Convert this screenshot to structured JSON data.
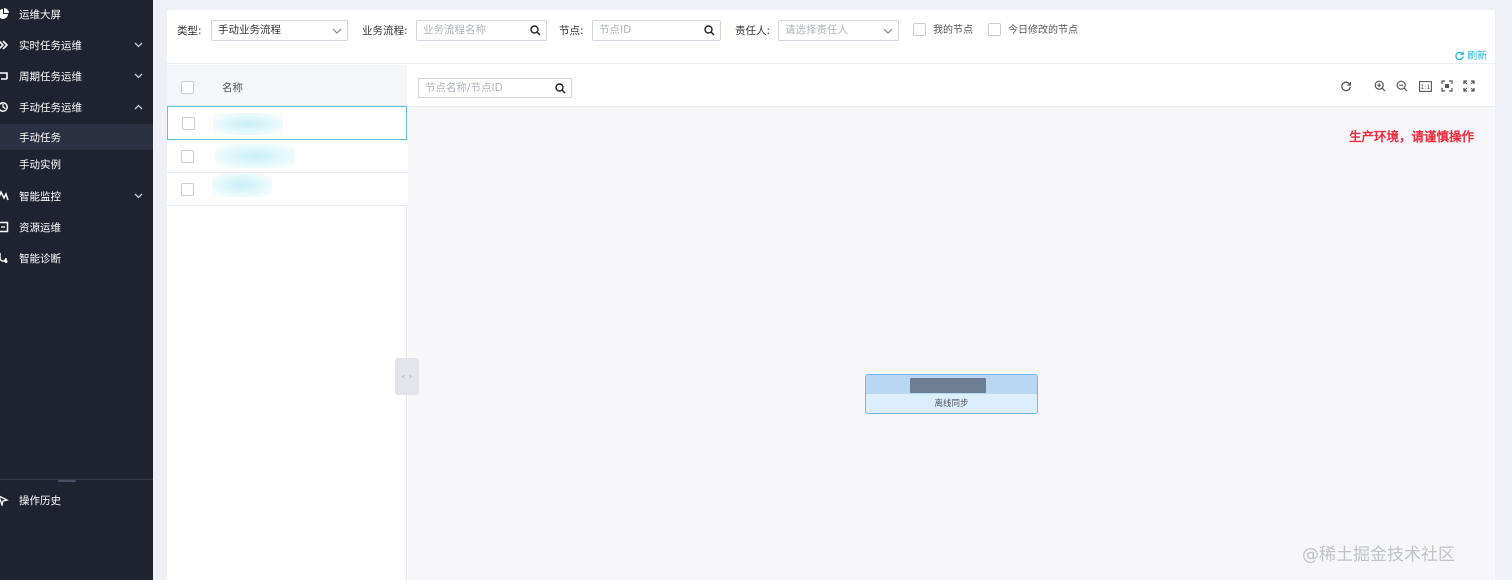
{
  "sidebar": {
    "items": [
      {
        "label": "运维大屏",
        "icon": "pie-chart-icon",
        "expandable": false
      },
      {
        "label": "实时任务运维",
        "icon": "realtime-icon",
        "expandable": true
      },
      {
        "label": "周期任务运维",
        "icon": "cycle-icon",
        "expandable": true
      },
      {
        "label": "手动任务运维",
        "icon": "manual-icon",
        "expandable": true,
        "expanded": true,
        "children": [
          {
            "label": "手动任务",
            "active": true
          },
          {
            "label": "手动实例",
            "active": false
          }
        ]
      },
      {
        "label": "智能监控",
        "icon": "monitor-icon",
        "expandable": true
      },
      {
        "label": "资源运维",
        "icon": "resource-icon",
        "expandable": false
      },
      {
        "label": "智能诊断",
        "icon": "diagnose-icon",
        "expandable": false
      }
    ],
    "footer": {
      "label": "操作历史",
      "icon": "history-icon"
    }
  },
  "filters": {
    "type_label": "类型:",
    "type_value": "手动业务流程",
    "flow_label": "业务流程:",
    "flow_placeholder": "业务流程名称",
    "node_label": "节点:",
    "node_placeholder": "节点ID",
    "owner_label": "责任人:",
    "owner_placeholder": "请选择责任人",
    "my_nodes": "我的节点",
    "today_modified": "今日修改的节点",
    "refresh": "刷新"
  },
  "list": {
    "column_name": "名称",
    "rows": [
      {
        "selected": true
      },
      {
        "selected": false
      },
      {
        "selected": false
      }
    ]
  },
  "graph": {
    "search_placeholder": "节点名称/节点ID",
    "warning": "生产环境，请谨慎操作",
    "node_subtitle": "离线同步",
    "toolbar_icons": [
      "refresh-icon",
      "zoom-in-icon",
      "zoom-out-icon",
      "actual-size-icon",
      "fit-view-icon",
      "fullscreen-icon"
    ],
    "zoom_text": "1:1"
  },
  "watermark": "@稀土掘金技术社区",
  "colors": {
    "sidebar_bg": "#1f2330",
    "accent": "#1fb8d8",
    "warning": "#f0283c",
    "node_border": "#6fb7e6"
  }
}
